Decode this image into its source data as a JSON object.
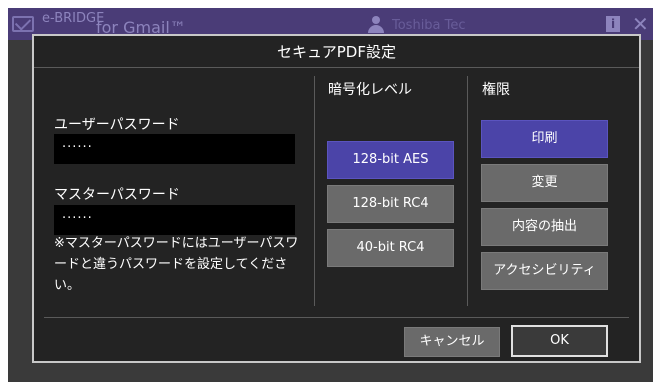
{
  "appbar": {
    "brand": "e-BRIDGE",
    "brand_sub": "for Gmail™",
    "user_name": "Toshiba Tec",
    "info_label": "i",
    "close_label": "✕"
  },
  "dialog": {
    "title": "セキュアPDF設定",
    "user_password_label": "ユーザーパスワード",
    "user_password_value": "······",
    "master_password_label": "マスターパスワード",
    "master_password_value": "······",
    "note": "※マスターパスワードにはユーザーパスワードと違うパスワードを設定してください。",
    "encryption": {
      "heading": "暗号化レベル",
      "options": [
        "128-bit AES",
        "128-bit RC4",
        "40-bit RC4"
      ],
      "selected": "128-bit AES"
    },
    "permissions": {
      "heading": "権限",
      "options": [
        "印刷",
        "変更",
        "内容の抽出",
        "アクセシビリティ"
      ],
      "selected": [
        "印刷"
      ]
    },
    "cancel_label": "キャンセル",
    "ok_label": "OK"
  },
  "colors": {
    "appbar_bg": "#4a3c77",
    "dialog_bg": "#232323",
    "selected_button": "#4b44a8",
    "button": "#6a6a6a"
  }
}
